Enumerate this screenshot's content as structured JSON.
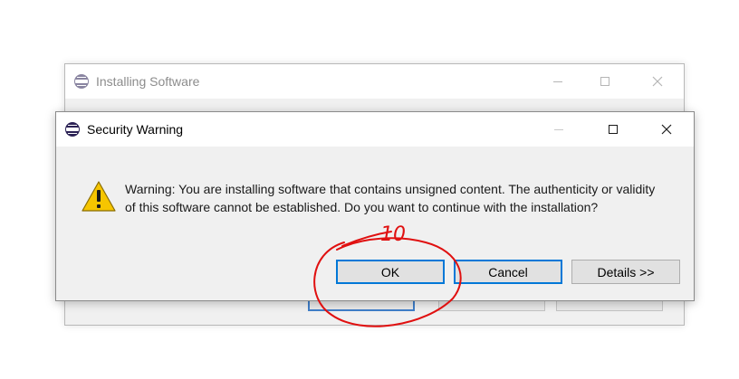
{
  "background_window": {
    "title": "Installing Software",
    "icon": "eclipse-icon"
  },
  "dialog": {
    "title": "Security Warning",
    "icon": "eclipse-icon",
    "message_icon": "warning-icon",
    "message": "Warning: You are installing software that contains unsigned content. The authenticity or validity of this software cannot be established. Do you want to continue with the installation?",
    "buttons": {
      "ok": "OK",
      "cancel": "Cancel",
      "details": "Details >>"
    }
  },
  "annotation": {
    "text": "10",
    "color": "#e01010"
  },
  "colors": {
    "focus_border": "#0078d7",
    "warning_fill": "#f6c500",
    "dialog_bg": "#f0f0f0"
  }
}
